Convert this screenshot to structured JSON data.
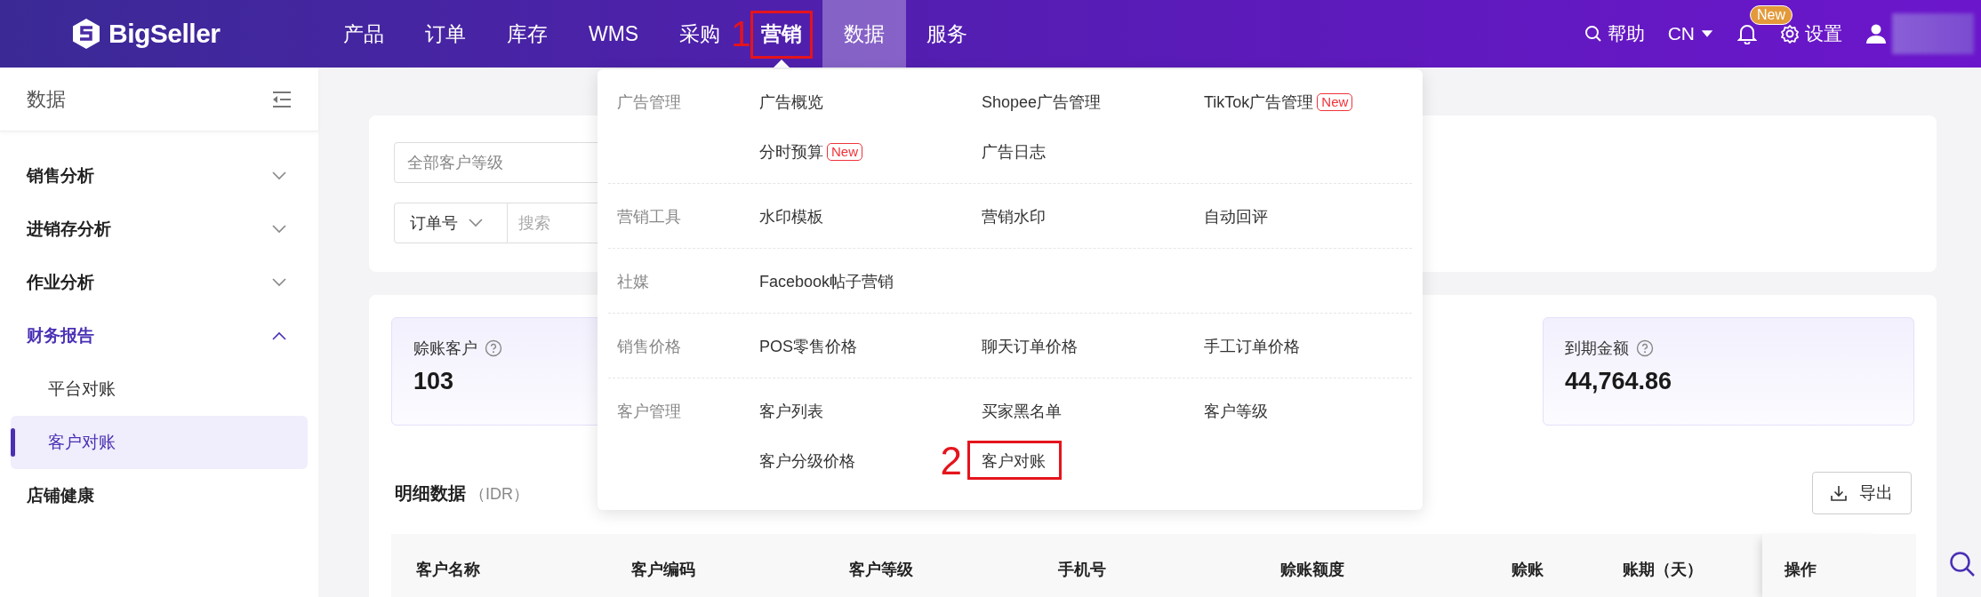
{
  "top_nav": {
    "logo": "BigSeller",
    "items": [
      {
        "label": "产品",
        "selected": false,
        "open": false
      },
      {
        "label": "订单",
        "selected": false,
        "open": false
      },
      {
        "label": "库存",
        "selected": false,
        "open": false
      },
      {
        "label": "WMS",
        "selected": false,
        "open": false
      },
      {
        "label": "采购",
        "selected": false,
        "open": false
      },
      {
        "label": "营销",
        "selected": false,
        "open": true,
        "annotation": "1"
      },
      {
        "label": "数据",
        "selected": true,
        "open": false
      },
      {
        "label": "服务",
        "selected": false,
        "open": false
      }
    ],
    "help": "帮助",
    "language": "CN",
    "notification_badge": "New",
    "settings": "设置"
  },
  "sidebar": {
    "title": "数据",
    "items": [
      {
        "label": "销售分析",
        "expanded": false,
        "selected": false
      },
      {
        "label": "进销存分析",
        "expanded": false,
        "selected": false
      },
      {
        "label": "作业分析",
        "expanded": false,
        "selected": false
      },
      {
        "label": "财务报告",
        "expanded": true,
        "selected": true,
        "children": [
          {
            "label": "平台对账",
            "selected": false
          },
          {
            "label": "客户对账",
            "selected": true
          }
        ]
      },
      {
        "label": "店铺健康",
        "selected": false
      }
    ]
  },
  "filters": {
    "level_select": "全部客户等级",
    "search_type": "订单号",
    "search": {
      "placeholder": "搜索"
    }
  },
  "stats": [
    {
      "label": "赊账客户",
      "value": "103"
    },
    {
      "label": "到期金额",
      "value": "44,764.86"
    }
  ],
  "details": {
    "title": "明细数据",
    "currency": "（IDR）",
    "export": "导出",
    "columns": [
      "客户名称",
      "客户编码",
      "客户等级",
      "手机号",
      "赊账额度",
      "赊账",
      "账期（天）",
      "操作"
    ]
  },
  "marketing_menu": {
    "groups": [
      {
        "label": "广告管理",
        "items": [
          {
            "label": "广告概览"
          },
          {
            "label": "Shopee广告管理"
          },
          {
            "label": "TikTok广告管理",
            "badge": "New"
          },
          {
            "label": "分时预算",
            "badge": "New"
          },
          {
            "label": "广告日志"
          }
        ]
      },
      {
        "label": "营销工具",
        "items": [
          {
            "label": "水印模板"
          },
          {
            "label": "营销水印"
          },
          {
            "label": "自动回评"
          }
        ]
      },
      {
        "label": "社媒",
        "items": [
          {
            "label": "Facebook帖子营销"
          }
        ]
      },
      {
        "label": "销售价格",
        "items": [
          {
            "label": "POS零售价格"
          },
          {
            "label": "聊天订单价格"
          },
          {
            "label": "手工订单价格"
          }
        ]
      },
      {
        "label": "客户管理",
        "items": [
          {
            "label": "客户列表"
          },
          {
            "label": "买家黑名单"
          },
          {
            "label": "客户等级"
          },
          {
            "label": "客户分级价格"
          },
          {
            "label": "客户对账",
            "annotation": "2"
          }
        ]
      }
    ]
  }
}
